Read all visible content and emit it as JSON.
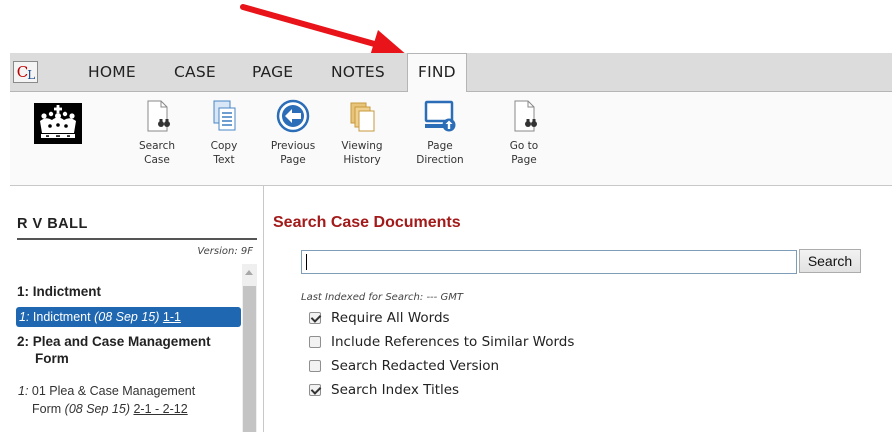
{
  "logo": {
    "c": "C",
    "l": "L"
  },
  "tabs": [
    {
      "label": "HOME",
      "active": false
    },
    {
      "label": "CASE",
      "active": false
    },
    {
      "label": "PAGE",
      "active": false
    },
    {
      "label": "NOTES",
      "active": false
    },
    {
      "label": "FIND",
      "active": true
    }
  ],
  "ribbon": [
    {
      "label": "Search\nCase",
      "icon": "search-case-icon"
    },
    {
      "label": "Copy\nText",
      "icon": "copy-text-icon"
    },
    {
      "label": "Previous\nPage",
      "icon": "previous-page-icon"
    },
    {
      "label": "Viewing\nHistory",
      "icon": "viewing-history-icon"
    },
    {
      "label": "Page\nDirection",
      "icon": "page-direction-icon"
    },
    {
      "label": "Go to\nPage",
      "icon": "go-to-page-icon"
    }
  ],
  "case": {
    "title": "R V BALL",
    "version": "Version: 9F"
  },
  "sections": [
    {
      "label": "1:  Indictment"
    },
    {
      "label": "2:  Plea and Case Management",
      "label2": "Form"
    }
  ],
  "items": [
    {
      "num": "1:",
      "name": "Indictment",
      "date": "(08 Sep 15)",
      "pages": "1-1",
      "selected": true
    },
    {
      "num": "1:",
      "name": "01 Plea & Case Management",
      "name2": "Form",
      "date": "(08 Sep 15)",
      "pages": "2-1 - 2-12",
      "selected": false
    }
  ],
  "search": {
    "title": "Search Case Documents",
    "input_value": "",
    "button_label": "Search",
    "last_indexed": "Last Indexed for Search: --- GMT",
    "options": [
      {
        "label": "Require All Words",
        "checked": true
      },
      {
        "label": "Include References to Similar Words",
        "checked": false
      },
      {
        "label": "Search Redacted Version",
        "checked": false
      },
      {
        "label": "Search Index Titles",
        "checked": true
      }
    ]
  },
  "colors": {
    "accent_red": "#a31a1a",
    "selection_blue": "#1f67b1",
    "arrow_red": "#e8141a"
  }
}
